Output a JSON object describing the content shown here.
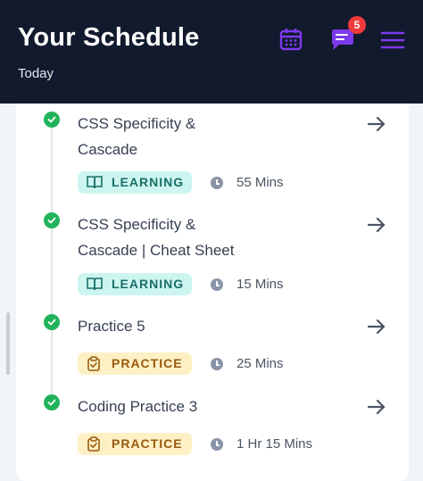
{
  "header": {
    "title": "Your Schedule",
    "subtitle": "Today",
    "notification_count": "5",
    "icons": [
      "calendar-icon",
      "chat-icon",
      "menu-icon"
    ],
    "colors": {
      "background": "#121a2e",
      "accent": "#7c3aed",
      "badge": "#ef3b3b"
    }
  },
  "items": [
    {
      "title_line1": "CSS Specificity &",
      "title_line2": "Cascade",
      "tag": "LEARNING",
      "duration": "55 Mins",
      "status": "completed"
    },
    {
      "title_line1": "CSS Specificity &",
      "title_line2": "Cascade | Cheat Sheet",
      "tag": "LEARNING",
      "duration": "15 Mins",
      "status": "completed"
    },
    {
      "title_line1": "Practice 5",
      "title_line2": "",
      "tag": "PRACTICE",
      "duration": "25 Mins",
      "status": "completed"
    },
    {
      "title_line1": "Coding Practice 3",
      "title_line2": "",
      "tag": "PRACTICE",
      "duration": "1 Hr 15 Mins",
      "status": "completed"
    }
  ]
}
